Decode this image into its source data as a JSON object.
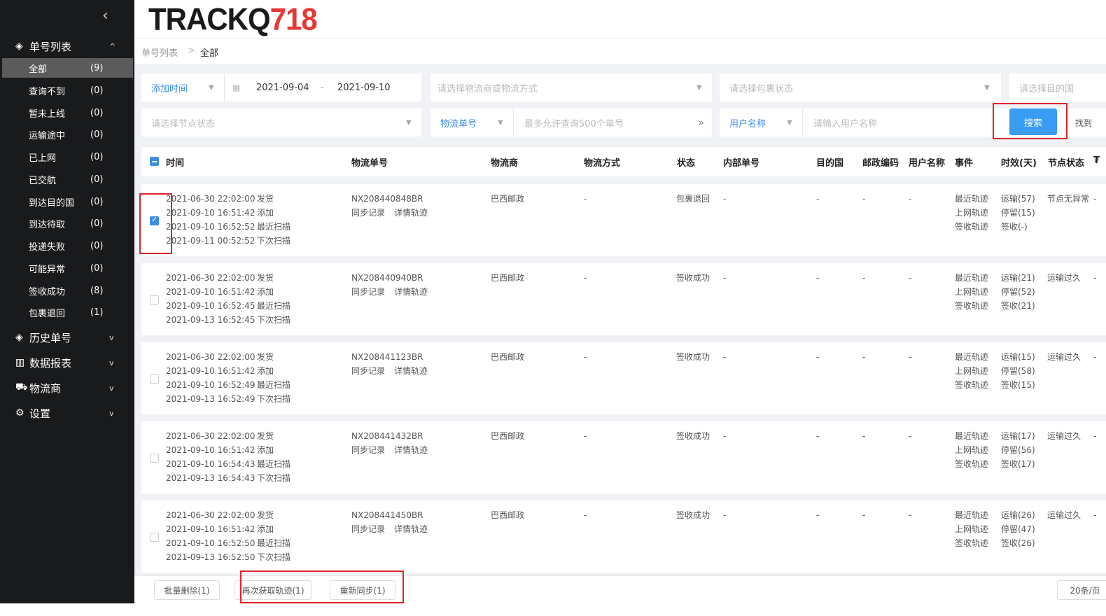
{
  "sidebar": {
    "collapse_glyph": "‹",
    "sections": [
      {
        "label": "单号列表",
        "icon": "target-icon",
        "glyph": "◈",
        "chev": "^"
      },
      {
        "label": "历史单号",
        "icon": "target-icon",
        "glyph": "◈",
        "chev": "v"
      },
      {
        "label": "数据报表",
        "icon": "bar-chart-icon",
        "glyph": "▥",
        "chev": "v"
      },
      {
        "label": "物流商",
        "icon": "truck-icon",
        "glyph": "⛟",
        "chev": "v"
      },
      {
        "label": "设置",
        "icon": "gear-icon",
        "glyph": "⚙",
        "chev": "v"
      }
    ],
    "items": [
      {
        "label": "全部",
        "count": "(9)"
      },
      {
        "label": "查询不到",
        "count": "(0)"
      },
      {
        "label": "暂未上线",
        "count": "(0)"
      },
      {
        "label": "运输途中",
        "count": "(0)"
      },
      {
        "label": "已上网",
        "count": "(0)"
      },
      {
        "label": "已交航",
        "count": "(0)"
      },
      {
        "label": "到达目的国",
        "count": "(0)"
      },
      {
        "label": "到达待取",
        "count": "(0)"
      },
      {
        "label": "投递失败",
        "count": "(0)"
      },
      {
        "label": "可能异常",
        "count": "(0)"
      },
      {
        "label": "签收成功",
        "count": "(8)"
      },
      {
        "label": "包裹退回",
        "count": "(1)"
      }
    ]
  },
  "logo": {
    "text": "TRACKQ",
    "num": "718"
  },
  "breadcrumb": {
    "root": "单号列表",
    "sep": ">",
    "current": "全部"
  },
  "filters": {
    "time_type": "添加时间",
    "date_start": "2021-09-04",
    "date_dash": "-",
    "date_end": "2021-09-10",
    "carrier_ph": "请选择物流商或物流方式",
    "pkg_status_ph": "请选择包裹状态",
    "dest_ph": "请选择目的国",
    "node_status_ph": "请选择节点状态",
    "number_type": "物流单号",
    "number_ph": "最多允许查询500个单号",
    "expand_glyph": "»",
    "user_type": "用户名称",
    "user_ph": "请输入用户名称",
    "search_btn": "搜索",
    "find_label": "找到"
  },
  "table": {
    "headers": [
      "时间",
      "物流单号",
      "物流商",
      "物流方式",
      "状态",
      "内部单号",
      "目的国",
      "邮政编码",
      "用户名称",
      "事件",
      "时效(天)",
      "节点状态",
      "₮"
    ],
    "sync_label": "同步记录",
    "detail_label": "详情轨迹",
    "time_labels": [
      "发货",
      "添加",
      "最近扫描",
      "下次扫描"
    ],
    "event_labels": [
      "最近轨迹",
      "上网轨迹",
      "签收轨迹"
    ],
    "dash": "-",
    "rows": [
      {
        "times": [
          "2021-06-30 22:02:00",
          "2021-09-10 16:51:42",
          "2021-09-10 16:52:52",
          "2021-09-11 00:52:52"
        ],
        "number": "NX208440848BR",
        "carrier": "巴西邮政",
        "method": "-",
        "status": "包裹退回",
        "internal": "-",
        "dest": "-",
        "zip": "-",
        "user": "-",
        "aging": [
          "运输(57)",
          "停留(15)",
          "签收(-)"
        ],
        "node": "节点无异常",
        "checked": true
      },
      {
        "times": [
          "2021-06-30 22:02:00",
          "2021-09-10 16:51:42",
          "2021-09-10 16:52:45",
          "2021-09-13 16:52:45"
        ],
        "number": "NX208440940BR",
        "carrier": "巴西邮政",
        "method": "-",
        "status": "签收成功",
        "internal": "-",
        "dest": "-",
        "zip": "-",
        "user": "-",
        "aging": [
          "运输(21)",
          "停留(52)",
          "签收(21)"
        ],
        "node": "运输过久",
        "checked": false
      },
      {
        "times": [
          "2021-06-30 22:02:00",
          "2021-09-10 16:51:42",
          "2021-09-10 16:52:49",
          "2021-09-13 16:52:49"
        ],
        "number": "NX208441123BR",
        "carrier": "巴西邮政",
        "method": "-",
        "status": "签收成功",
        "internal": "-",
        "dest": "-",
        "zip": "-",
        "user": "-",
        "aging": [
          "运输(15)",
          "停留(58)",
          "签收(15)"
        ],
        "node": "运输过久",
        "checked": false
      },
      {
        "times": [
          "2021-06-30 22:02:00",
          "2021-09-10 16:51:42",
          "2021-09-10 16:54:43",
          "2021-09-13 16:54:43"
        ],
        "number": "NX208441432BR",
        "carrier": "巴西邮政",
        "method": "-",
        "status": "签收成功",
        "internal": "-",
        "dest": "-",
        "zip": "-",
        "user": "-",
        "aging": [
          "运输(17)",
          "停留(56)",
          "签收(17)"
        ],
        "node": "运输过久",
        "checked": false
      },
      {
        "times": [
          "2021-06-30 22:02:00",
          "2021-09-10 16:51:42",
          "2021-09-10 16:52:50",
          "2021-09-13 16:52:50"
        ],
        "number": "NX208441450BR",
        "carrier": "巴西邮政",
        "method": "-",
        "status": "签收成功",
        "internal": "-",
        "dest": "-",
        "zip": "-",
        "user": "-",
        "aging": [
          "运输(26)",
          "停留(47)",
          "签收(26)"
        ],
        "node": "运输过久",
        "checked": false
      }
    ]
  },
  "bottom": {
    "batch_delete": "批量删除(1)",
    "refetch": "再次获取轨迹(1)",
    "resync": "重新同步(1)",
    "page_size": "20条/页"
  },
  "colors": {
    "accent": "#3a8ee6",
    "sidebar_bg": "#191a1c",
    "highlight": "#e0242a",
    "success": "#52c41a",
    "danger": "#f5222d"
  }
}
